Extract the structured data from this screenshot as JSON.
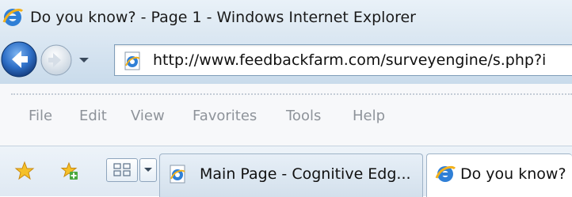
{
  "window": {
    "title": "Do you know? - Page 1 - Windows Internet Explorer"
  },
  "navigation": {
    "address": "http://www.feedbackfarm.com/surveyengine/s.php?i"
  },
  "menu": {
    "items": [
      "File",
      "Edit",
      "View",
      "Favorites",
      "Tools",
      "Help"
    ]
  },
  "tabs": [
    {
      "label": "Main Page - Cognitive Edg..."
    },
    {
      "label": "Do you know?"
    }
  ],
  "colors": {
    "menu_text": "#8e939a",
    "ie_blue": "#2f7fd6",
    "ie_gold": "#f2b11d",
    "back_arrow_blue": "#1f5fb8"
  },
  "icons": {
    "title": "ie-logo-icon",
    "back": "back-arrow-icon",
    "forward": "forward-arrow-icon",
    "history": "chevron-down-icon",
    "address": "ie-page-icon",
    "favorites": "favorites-star-icon",
    "add_favorites": "add-favorites-icon",
    "quick_tabs": "quick-tabs-grid-icon",
    "tab_list": "chevron-down-icon"
  }
}
